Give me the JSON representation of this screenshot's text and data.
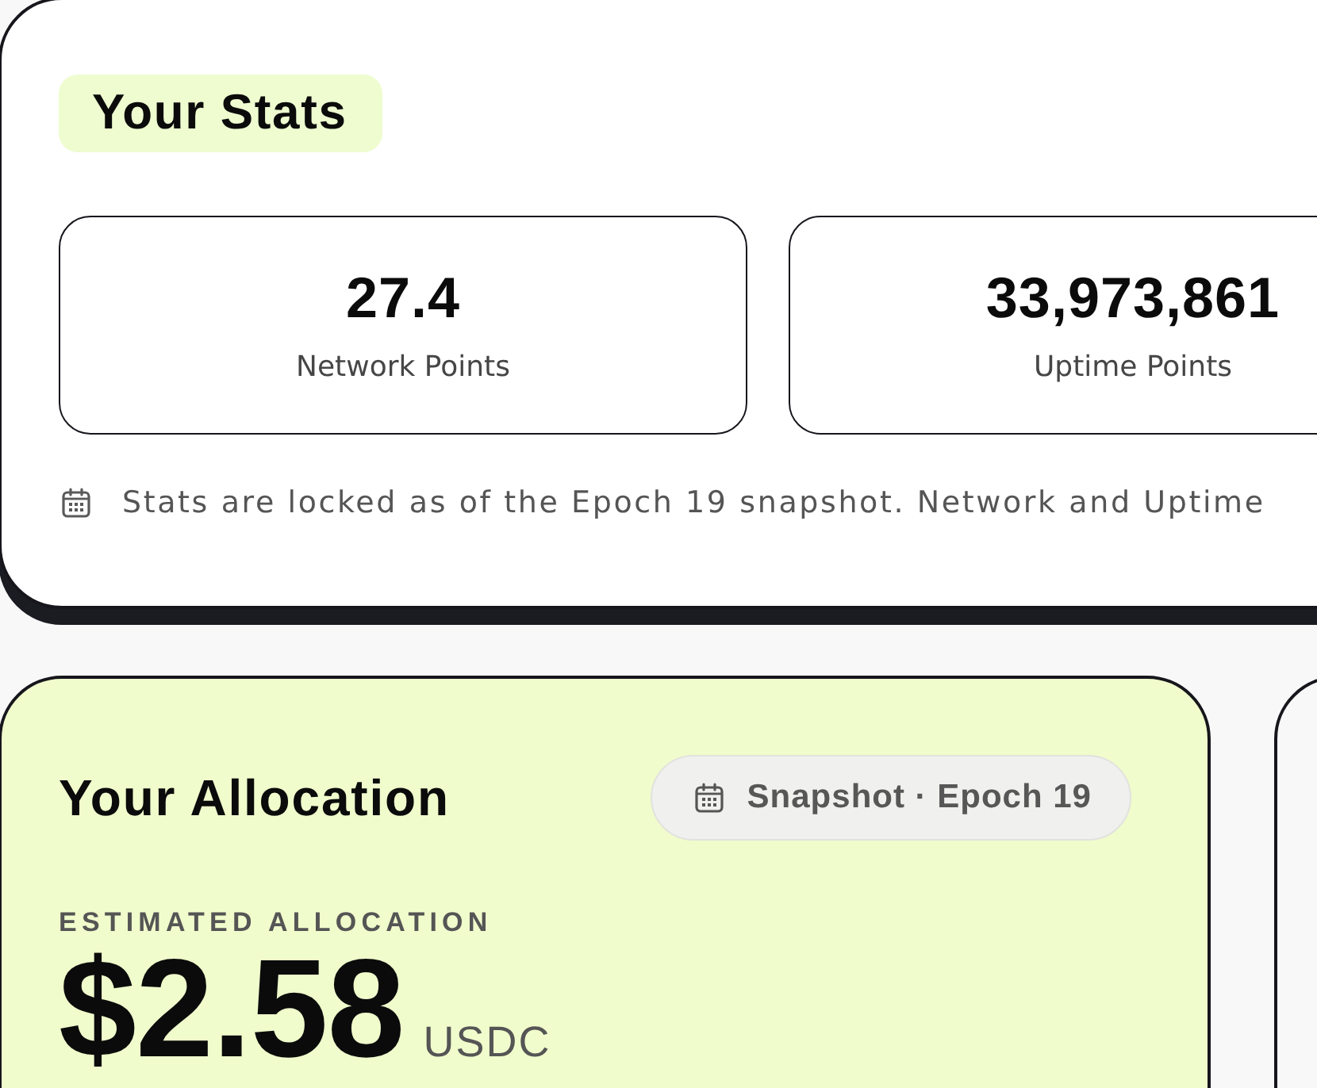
{
  "stats": {
    "title": "Your Stats",
    "items": [
      {
        "value": "27.4",
        "label": "Network Points"
      },
      {
        "value": "33,973,861",
        "label": "Uptime Points"
      }
    ],
    "note": "Stats are locked as of the Epoch 19 snapshot. Network and Uptime"
  },
  "allocation": {
    "title": "Your Allocation",
    "badge": "Snapshot · Epoch 19",
    "label": "ESTIMATED ALLOCATION",
    "amount": "$2.58",
    "currency": "USDC"
  }
}
